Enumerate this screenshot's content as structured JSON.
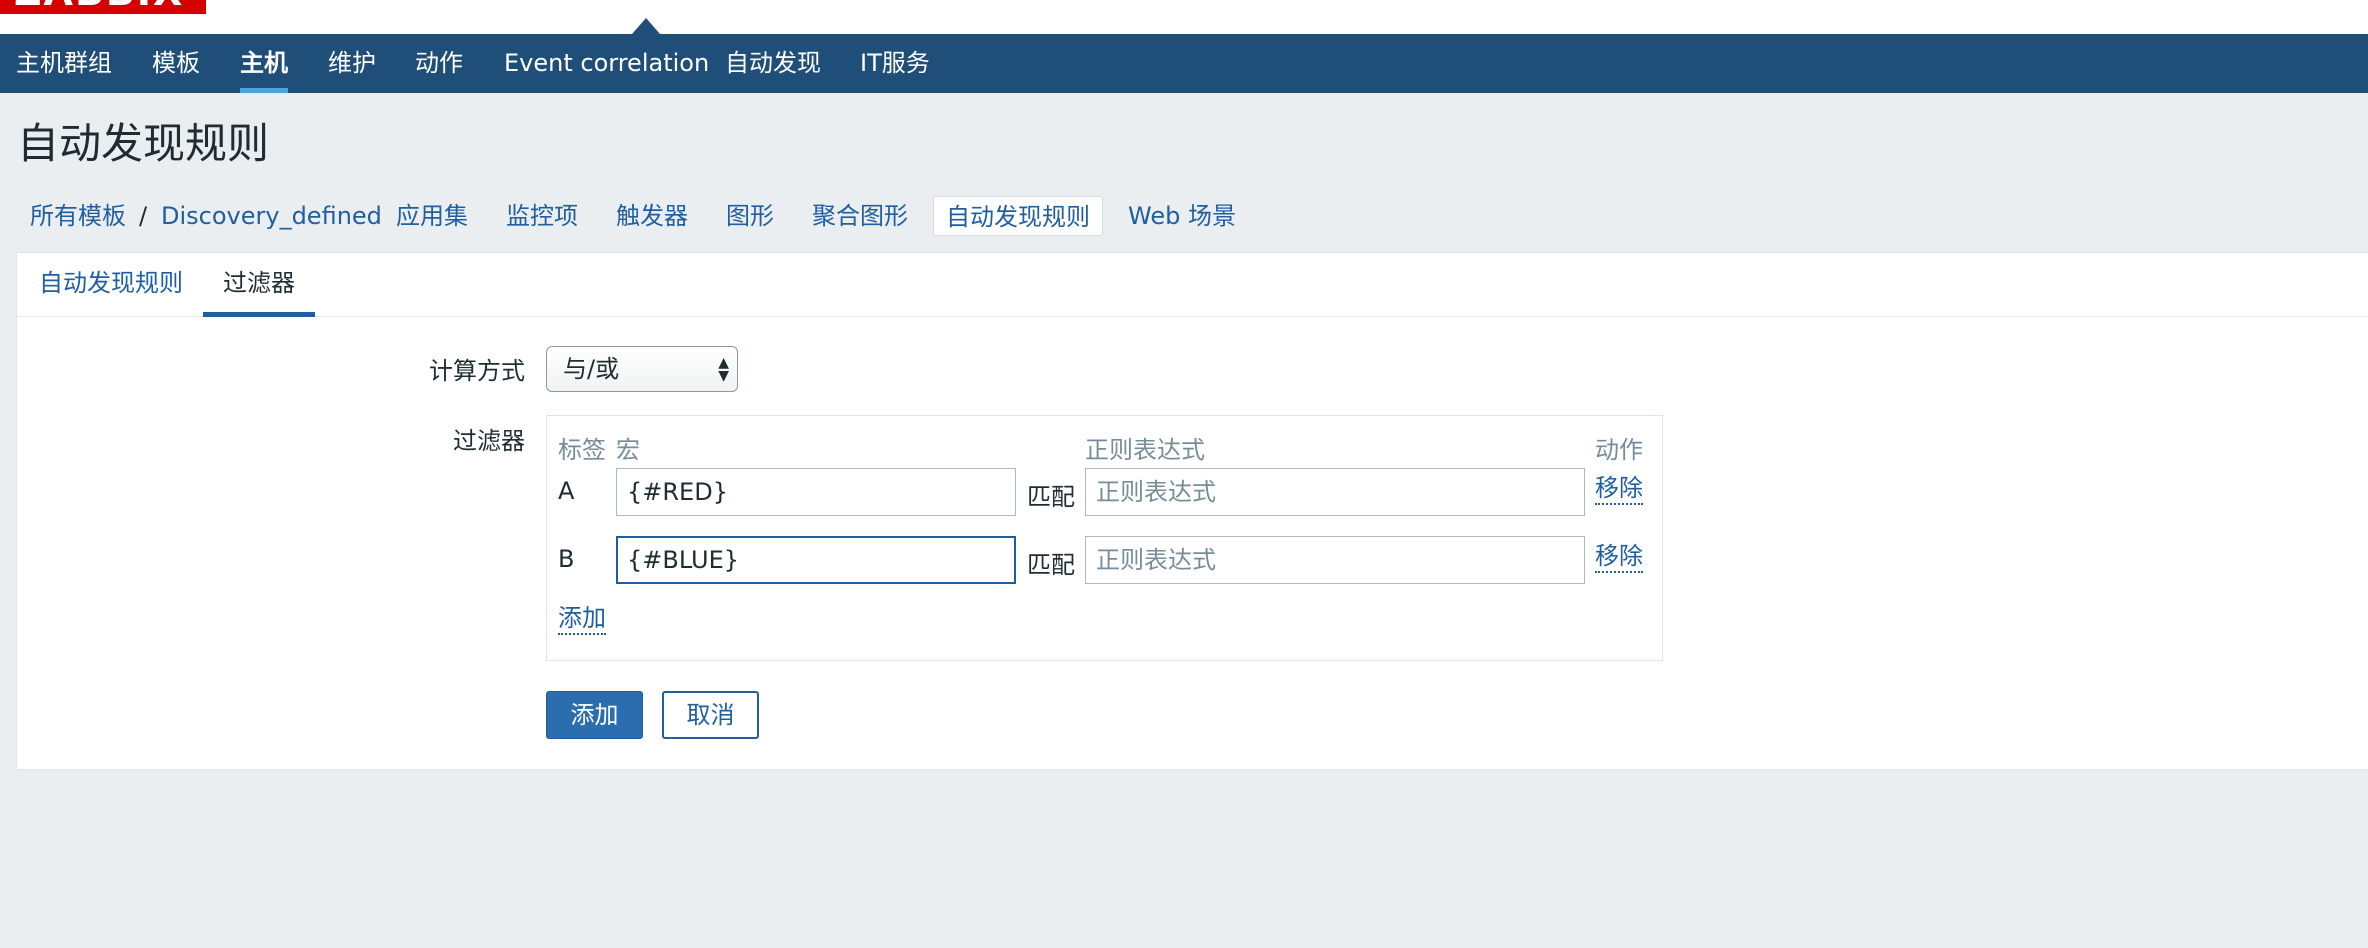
{
  "brand": {
    "logo_text": "ZABBIX"
  },
  "navbar": {
    "items": [
      {
        "label": "主机群组",
        "active": false
      },
      {
        "label": "模板",
        "active": false
      },
      {
        "label": "主机",
        "active": true
      },
      {
        "label": "维护",
        "active": false
      },
      {
        "label": "动作",
        "active": false
      },
      {
        "label": "Event correlation",
        "active": false
      },
      {
        "label": "自动发现",
        "active": false
      },
      {
        "label": "IT服务",
        "active": false
      }
    ]
  },
  "page": {
    "title": "自动发现规则"
  },
  "breadcrumbs": {
    "all_templates": "所有模板",
    "separator": "/",
    "template": "Discovery_defined",
    "links": [
      "应用集",
      "监控项",
      "触发器",
      "图形",
      "聚合图形",
      "自动发现规则",
      "Web 场景"
    ],
    "active_link": "自动发现规则"
  },
  "tabs": [
    {
      "label": "自动发现规则",
      "active": false
    },
    {
      "label": "过滤器",
      "active": true
    }
  ],
  "form": {
    "calc_label": "计算方式",
    "calc_value": "与/或",
    "filter_label": "过滤器",
    "columns": {
      "label": "标签",
      "macro": "宏",
      "regex": "正则表达式",
      "action": "动作"
    },
    "rows": [
      {
        "label": "A",
        "macro": "{#RED}",
        "match": "匹配",
        "regex_placeholder": "正则表达式",
        "remove": "移除"
      },
      {
        "label": "B",
        "macro": "{#BLUE}",
        "match": "匹配",
        "regex_placeholder": "正则表达式",
        "remove": "移除"
      }
    ],
    "add_link": "添加",
    "submit_label": "添加",
    "cancel_label": "取消"
  },
  "colors": {
    "nav_bg": "#1f4e79",
    "link": "#1f5fa0",
    "primary_button": "#2a6eb0",
    "page_bg": "#ebeef0",
    "logo_bg": "#d40000"
  }
}
